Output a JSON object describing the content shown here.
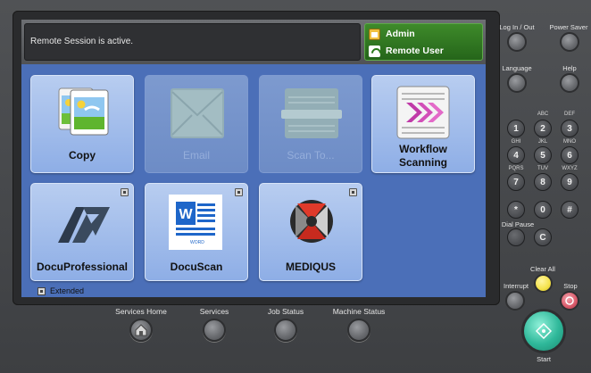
{
  "status": {
    "session_message": "Remote Session is active.",
    "user_role": "Admin",
    "user_name": "Remote User"
  },
  "apps": [
    {
      "label": "Copy",
      "enabled": true,
      "icon": "copy-icon"
    },
    {
      "label": "Email",
      "enabled": false,
      "icon": "email-icon"
    },
    {
      "label": "Scan To...",
      "enabled": false,
      "icon": "scan-icon"
    },
    {
      "label_line1": "Workflow",
      "label_line2": "Scanning",
      "enabled": true,
      "icon": "workflow-icon"
    },
    {
      "label": "DocuProfessional",
      "enabled": true,
      "icon": "docuprofessional-icon"
    },
    {
      "label": "DocuScan",
      "enabled": true,
      "icon": "docuscan-icon",
      "icon_text": "WORD"
    },
    {
      "label": "MEDIQUS",
      "enabled": true,
      "icon": "mediqus-icon"
    }
  ],
  "extended_label": "Extended",
  "bottom_buttons": [
    {
      "label": "Services Home",
      "icon": "home-icon"
    },
    {
      "label": "Services"
    },
    {
      "label": "Job Status"
    },
    {
      "label": "Machine Status"
    }
  ],
  "side_buttons": {
    "login": "Log In / Out",
    "power_saver": "Power Saver",
    "language": "Language",
    "help": "Help",
    "dial_pause": "Dial Pause",
    "clear_all": "Clear All",
    "interrupt": "Interrupt",
    "stop": "Stop",
    "start": "Start"
  },
  "keypad": [
    {
      "key": "1",
      "sub": ""
    },
    {
      "key": "2",
      "sub": "ABC"
    },
    {
      "key": "3",
      "sub": "DEF"
    },
    {
      "key": "4",
      "sub": "GHI"
    },
    {
      "key": "5",
      "sub": "JKL"
    },
    {
      "key": "6",
      "sub": "MNO"
    },
    {
      "key": "7",
      "sub": "PQRS"
    },
    {
      "key": "8",
      "sub": "TUV"
    },
    {
      "key": "9",
      "sub": "WXYZ"
    },
    {
      "key": "*",
      "sub": ""
    },
    {
      "key": "0",
      "sub": ""
    },
    {
      "key": "#",
      "sub": ""
    },
    {
      "key": "C",
      "sub": ""
    }
  ],
  "colors": {
    "screen_bg": "#4b6fb8",
    "user_panel": "#2e7a20",
    "clear_all": "#f4e24a",
    "stop": "#d95a6a",
    "start": "#2fb89a"
  }
}
